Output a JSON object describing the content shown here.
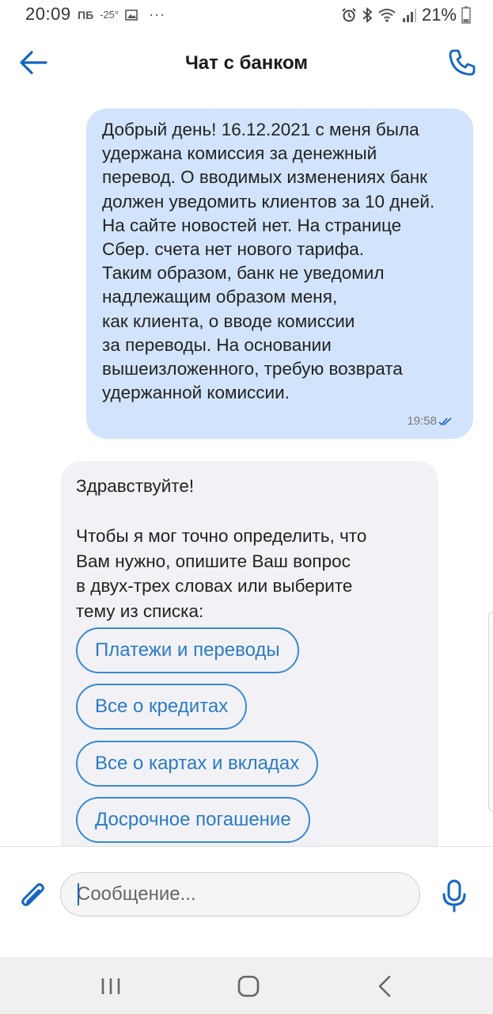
{
  "status_bar": {
    "time": "20:09",
    "left_label": "ПБ",
    "temperature": "-25°",
    "more": "···",
    "battery": "21%",
    "icons": [
      "image-icon",
      "alarm-icon",
      "bluetooth-icon",
      "wifi-icon",
      "signal-icon",
      "battery-icon"
    ]
  },
  "header": {
    "title": "Чат с банком",
    "back_icon": "arrow-left-icon",
    "call_icon": "phone-icon"
  },
  "messages": [
    {
      "direction": "outgoing",
      "text": "Добрый день! 16.12.2021 с меня была\nудержана комиссия за денежный\nперевод. О вводимых изменениях банк\nдолжен уведомить клиентов за 10 дней.\nНа сайте новостей нет. На странице\nСбер. счета нет нового тарифа.\nТаким образом, банк не уведомил\nнадлежащим образом меня,\nкак клиента, о вводе комиссии\nза переводы. На основании\nвышеизложенного, требую возврата\nудержанной комиссии.",
      "time": "19:58",
      "read_icon": "double-check-icon"
    },
    {
      "direction": "incoming",
      "text": "Здравствуйте!\n\nЧтобы я мог точно определить, что\nВам нужно, опишите Ваш вопрос\nв двух-трех словах или выберите\nтему из списка:",
      "options": [
        "Платежи и переводы",
        "Все о кредитах",
        "Все о картах и вкладах",
        "Досрочное погашение"
      ]
    }
  ],
  "composer": {
    "placeholder": "Сообщение...",
    "attach_icon": "paperclip-icon",
    "mic_icon": "microphone-icon"
  },
  "nav_bar": {
    "icons": [
      "recent-apps-icon",
      "home-icon",
      "back-icon"
    ]
  },
  "colors": {
    "accent": "#1565c0",
    "outgoing_bubble": "#d2e4fb",
    "incoming_bubble": "#f2f2f6",
    "chip_border": "#3a8ad0"
  }
}
